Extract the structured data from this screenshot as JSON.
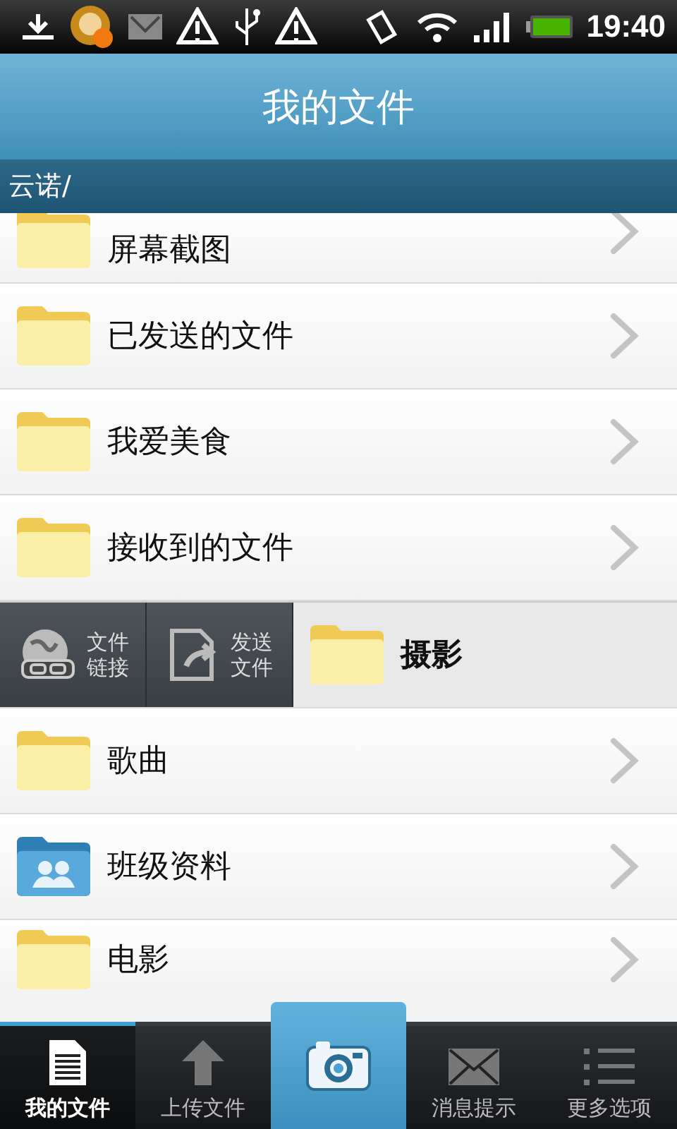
{
  "status_bar": {
    "time": "19:40"
  },
  "header": {
    "title": "我的文件"
  },
  "breadcrumb": "云诺/",
  "rows": [
    {
      "kind": "folder",
      "name": "屏幕截图"
    },
    {
      "kind": "folder",
      "name": "已发送的文件"
    },
    {
      "kind": "folder",
      "name": "我爱美食"
    },
    {
      "kind": "folder",
      "name": "接收到的文件"
    },
    {
      "kind": "swiped",
      "name": "摄影",
      "actions": [
        {
          "kind": "link",
          "label_lines": [
            "文件",
            "链接"
          ]
        },
        {
          "kind": "send",
          "label_lines": [
            "发送",
            "文件"
          ]
        }
      ]
    },
    {
      "kind": "folder",
      "name": "歌曲"
    },
    {
      "kind": "shared",
      "name": "班级资料"
    },
    {
      "kind": "folder",
      "name": "电影"
    }
  ],
  "tabs": [
    {
      "kind": "files",
      "label": "我的文件",
      "selected": true
    },
    {
      "kind": "upload",
      "label": "上传文件",
      "selected": false
    },
    {
      "kind": "camera",
      "selected": false
    },
    {
      "kind": "messages",
      "label": "消息提示",
      "selected": false
    },
    {
      "kind": "more",
      "label": "更多选项",
      "selected": false
    }
  ]
}
